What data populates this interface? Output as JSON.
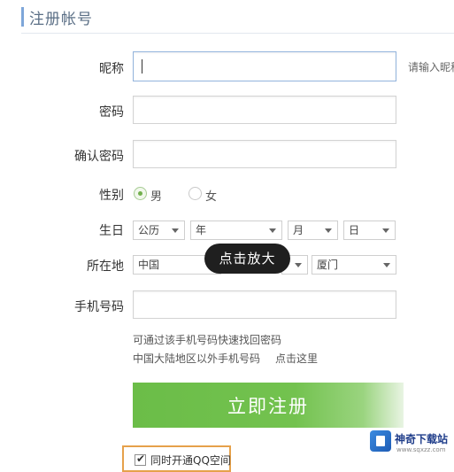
{
  "header": {
    "title": "注册帐号"
  },
  "form": {
    "nickname": {
      "label": "昵称",
      "value": "",
      "hint": "请输入昵称"
    },
    "password": {
      "label": "密码",
      "value": ""
    },
    "confirm_password": {
      "label": "确认密码",
      "value": ""
    },
    "gender": {
      "label": "性别",
      "options": [
        "男",
        "女"
      ],
      "selected": "男"
    },
    "birthday": {
      "label": "生日",
      "calendar": "公历",
      "year": "年",
      "month": "月",
      "day": "日"
    },
    "location": {
      "label": "所在地",
      "country": "中国",
      "city": "厦门"
    },
    "phone": {
      "label": "手机号码",
      "value": "",
      "tip1": "可通过该手机号码快速找回密码",
      "tip2": "中国大陆地区以外手机号码",
      "tip2_link": "点击这里"
    },
    "submit_label": "立即注册",
    "qzone_label": "同时开通QQ空间",
    "qzone_checked": true
  },
  "tooltip": {
    "text": "点击放大"
  },
  "watermark": {
    "title": "神奇下载站",
    "subtitle": "www.sqxzz.com"
  },
  "colors": {
    "submit": "#6bbd48",
    "accent": "#7ea6d9",
    "highlight_border": "#e6a14b",
    "tooltip_bg": "#1f1f1f"
  }
}
